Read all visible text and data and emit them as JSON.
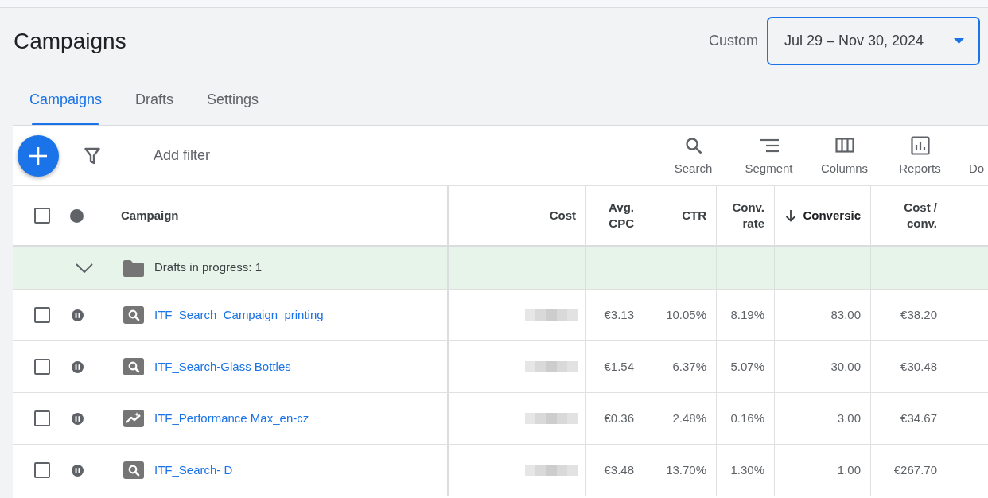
{
  "header": {
    "title": "Campaigns",
    "date_range": {
      "label": "Custom",
      "value": "Jul 29 – Nov 30, 2024"
    }
  },
  "tabs": [
    {
      "label": "Campaigns",
      "selected": true
    },
    {
      "label": "Drafts",
      "selected": false
    },
    {
      "label": "Settings",
      "selected": false
    }
  ],
  "toolbar": {
    "add_filter": "Add filter",
    "actions": [
      {
        "kind": "search",
        "label": "Search"
      },
      {
        "kind": "segment",
        "label": "Segment"
      },
      {
        "kind": "columns",
        "label": "Columns"
      },
      {
        "kind": "reports",
        "label": "Reports"
      },
      {
        "kind": "clipped",
        "label": "Do"
      }
    ]
  },
  "table": {
    "header": {
      "checked": false,
      "campaign": "Campaign"
    },
    "columns": [
      {
        "label": "Cost",
        "sorted": false
      },
      {
        "label": "Avg. CPC",
        "sorted": false
      },
      {
        "label": "CTR",
        "sorted": false
      },
      {
        "label": "Conv. rate",
        "sorted": false
      },
      {
        "label": "Conversic",
        "sorted": true
      },
      {
        "label": "Cost / conv.",
        "sorted": false
      }
    ],
    "group": {
      "label": "Drafts in progress: 1",
      "expanded": true
    },
    "rows": [
      {
        "checked": false,
        "paused": true,
        "kind": "search",
        "name": "ITF_Search_Campaign_printing",
        "cost_blurred": true,
        "values": [
          "€3.13",
          "10.05%",
          "8.19%",
          "83.00",
          "€38.20"
        ]
      },
      {
        "checked": false,
        "paused": true,
        "kind": "search",
        "name": "ITF_Search-Glass Bottles",
        "cost_blurred": true,
        "values": [
          "€1.54",
          "6.37%",
          "5.07%",
          "30.00",
          "€30.48"
        ]
      },
      {
        "checked": false,
        "paused": true,
        "kind": "performance_max",
        "name": "ITF_Performance Max_en-cz",
        "cost_blurred": true,
        "values": [
          "€0.36",
          "2.48%",
          "0.16%",
          "3.00",
          "€34.67"
        ]
      },
      {
        "checked": false,
        "paused": true,
        "kind": "search",
        "name": "ITF_Search- D",
        "cost_blurred": true,
        "values": [
          "€3.48",
          "13.70%",
          "1.30%",
          "1.00",
          "€267.70"
        ]
      }
    ]
  }
}
